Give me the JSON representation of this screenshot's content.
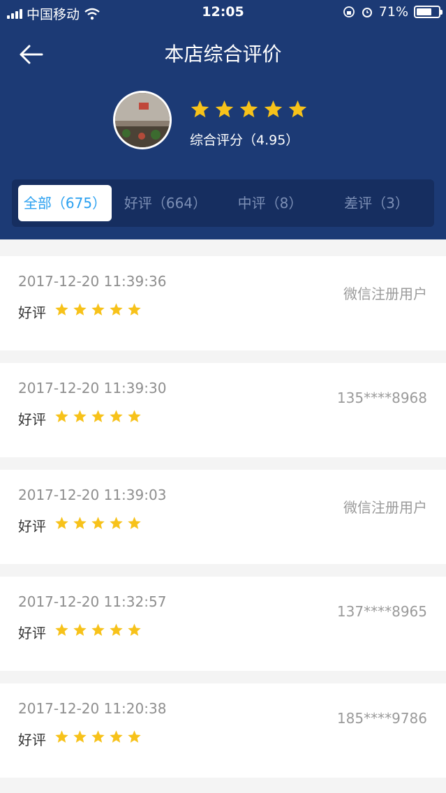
{
  "status_bar": {
    "carrier": "中国移动",
    "time": "12:05",
    "battery": "71%"
  },
  "header": {
    "title": "本店综合评价",
    "score_text": "综合评分（4.95）",
    "shop_rating_stars": 5
  },
  "tabs": [
    {
      "label": "全部（675）",
      "active": true
    },
    {
      "label": "好评（664）",
      "active": false
    },
    {
      "label": "中评（8）",
      "active": false
    },
    {
      "label": "差评（3）",
      "active": false
    }
  ],
  "reviews": [
    {
      "date": "2017-12-20 11:39:36",
      "user": "微信注册用户",
      "label": "好评",
      "stars": 5
    },
    {
      "date": "2017-12-20 11:39:30",
      "user": "135****8968",
      "label": "好评",
      "stars": 5
    },
    {
      "date": "2017-12-20 11:39:03",
      "user": "微信注册用户",
      "label": "好评",
      "stars": 5
    },
    {
      "date": "2017-12-20 11:32:57",
      "user": "137****8965",
      "label": "好评",
      "stars": 5
    },
    {
      "date": "2017-12-20 11:20:38",
      "user": "185****9786",
      "label": "好评",
      "stars": 5
    }
  ],
  "colors": {
    "header": "#1c3a75",
    "star": "#f7c21a",
    "tab_active_text": "#2aa0f0"
  }
}
